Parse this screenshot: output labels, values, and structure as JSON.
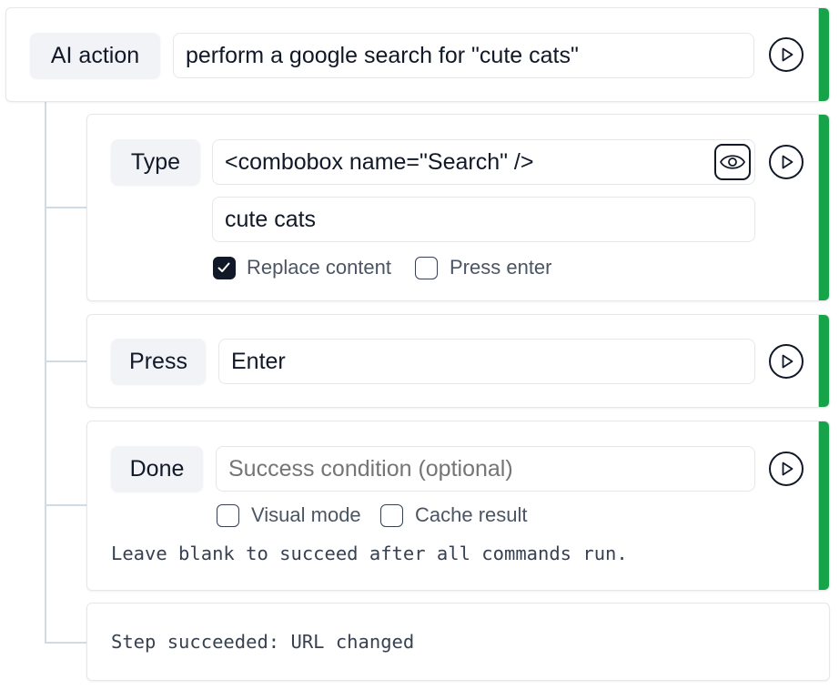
{
  "colors": {
    "status_success": "#16a34a",
    "chip_background": "#f1f3f6",
    "tree_line": "#d1dbe6"
  },
  "steps": {
    "ai_action": {
      "kind_label": "AI action",
      "instruction": "perform a google search for \"cute cats\"",
      "status": "success",
      "icon": "play-icon"
    },
    "type": {
      "kind_label": "Type",
      "target": "<combobox name=\"Search\" />",
      "text": "cute cats",
      "icons": [
        "eye-icon",
        "play-icon"
      ],
      "options": [
        {
          "label": "Replace content",
          "checked": true
        },
        {
          "label": "Press enter",
          "checked": false
        }
      ],
      "status": "success"
    },
    "press": {
      "kind_label": "Press",
      "key": "Enter",
      "status": "success",
      "icon": "play-icon"
    },
    "done": {
      "kind_label": "Done",
      "condition_value": "",
      "condition_placeholder": "Success condition (optional)",
      "options": [
        {
          "label": "Visual mode",
          "checked": false
        },
        {
          "label": "Cache result",
          "checked": false
        }
      ],
      "hint": "Leave blank to succeed after all commands run.",
      "status": "success",
      "icon": "play-icon"
    }
  },
  "result": {
    "message": "Step succeeded: URL changed"
  }
}
